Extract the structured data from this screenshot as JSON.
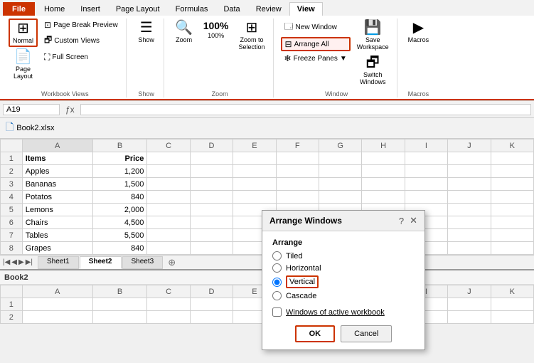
{
  "tabs": [
    "File",
    "Home",
    "Insert",
    "Page Layout",
    "Formulas",
    "Data",
    "Review",
    "View"
  ],
  "active_tab": "View",
  "ribbon": {
    "groups": [
      {
        "label": "Workbook Views",
        "buttons_large": [
          {
            "label": "Normal",
            "icon": "⊞"
          },
          {
            "label": "Page\nLayout",
            "icon": "📄"
          }
        ],
        "buttons_small": [
          {
            "label": "Page Break Preview",
            "icon": "⊡"
          },
          {
            "label": "Custom Views",
            "icon": "🗗"
          },
          {
            "label": "Full Screen",
            "icon": "⛶"
          }
        ]
      },
      {
        "label": "Show",
        "buttons_large": [
          {
            "label": "Show",
            "icon": "☰"
          }
        ]
      },
      {
        "label": "Zoom",
        "buttons_large": [
          {
            "label": "Zoom",
            "icon": "🔍"
          },
          {
            "label": "100%",
            "icon": "⊕"
          },
          {
            "label": "Zoom to\nSelection",
            "icon": "⊞"
          }
        ]
      },
      {
        "label": "Window",
        "buttons_small_first": [
          {
            "label": "New Window",
            "icon": "🗔",
            "highlighted": false
          },
          {
            "label": "Arrange All",
            "icon": "⊟",
            "highlighted": true
          },
          {
            "label": "Freeze Panes",
            "icon": "❄",
            "highlighted": false
          }
        ],
        "buttons_large_right": [
          {
            "label": "Save\nWorkspace",
            "icon": "💾"
          },
          {
            "label": "Switch\nWindows",
            "icon": "🗗"
          }
        ]
      },
      {
        "label": "Macros",
        "buttons_large": [
          {
            "label": "Macros",
            "icon": "▶"
          }
        ]
      }
    ]
  },
  "formula_bar": {
    "name_box": "A19",
    "formula": ""
  },
  "workbook_title": "Book2.xlsx",
  "spreadsheet": {
    "columns": [
      "A",
      "B",
      "C",
      "D",
      "E",
      "F",
      "G",
      "H",
      "I",
      "J",
      "K"
    ],
    "rows": [
      {
        "num": 1,
        "cells": [
          "Items",
          "Price",
          "",
          "",
          "",
          "",
          "",
          "",
          "",
          "",
          ""
        ]
      },
      {
        "num": 2,
        "cells": [
          "Apples",
          "1,200",
          "",
          "",
          "",
          "",
          "",
          "",
          "",
          "",
          ""
        ]
      },
      {
        "num": 3,
        "cells": [
          "Bananas",
          "1,500",
          "",
          "",
          "",
          "",
          "",
          "",
          "",
          "",
          ""
        ]
      },
      {
        "num": 4,
        "cells": [
          "Potatos",
          "840",
          "",
          "",
          "",
          "",
          "",
          "",
          "",
          "",
          ""
        ]
      },
      {
        "num": 5,
        "cells": [
          "Lemons",
          "2,000",
          "",
          "",
          "",
          "",
          "",
          "",
          "",
          "",
          ""
        ]
      },
      {
        "num": 6,
        "cells": [
          "Chairs",
          "4,500",
          "",
          "",
          "",
          "",
          "",
          "",
          "",
          "",
          ""
        ]
      },
      {
        "num": 7,
        "cells": [
          "Tables",
          "5,500",
          "",
          "",
          "",
          "",
          "",
          "",
          "",
          "",
          ""
        ]
      },
      {
        "num": 8,
        "cells": [
          "Grapes",
          "840",
          "",
          "",
          "",
          "",
          "",
          "",
          "",
          "",
          ""
        ]
      }
    ]
  },
  "sheet_tabs": [
    "Sheet1",
    "Sheet2",
    "Sheet3"
  ],
  "active_sheet": "Sheet2",
  "bottom_workbook": {
    "title": "Book2",
    "columns": [
      "A",
      "B",
      "C",
      "D",
      "E",
      "F",
      "G",
      "H",
      "I",
      "J",
      "K"
    ],
    "rows": [
      {
        "num": 1,
        "cells": [
          "",
          "",
          "",
          "",
          "",
          "",
          "",
          "",
          "",
          "",
          ""
        ]
      },
      {
        "num": 2,
        "cells": [
          "",
          "",
          "",
          "",
          "",
          "",
          "",
          "",
          "",
          "",
          ""
        ]
      }
    ]
  },
  "dialog": {
    "title": "Arrange Windows",
    "options": [
      "Tiled",
      "Horizontal",
      "Vertical",
      "Cascade"
    ],
    "selected": "Vertical",
    "checkbox_label": "Windows of active workbook",
    "ok_label": "OK",
    "cancel_label": "Cancel"
  }
}
